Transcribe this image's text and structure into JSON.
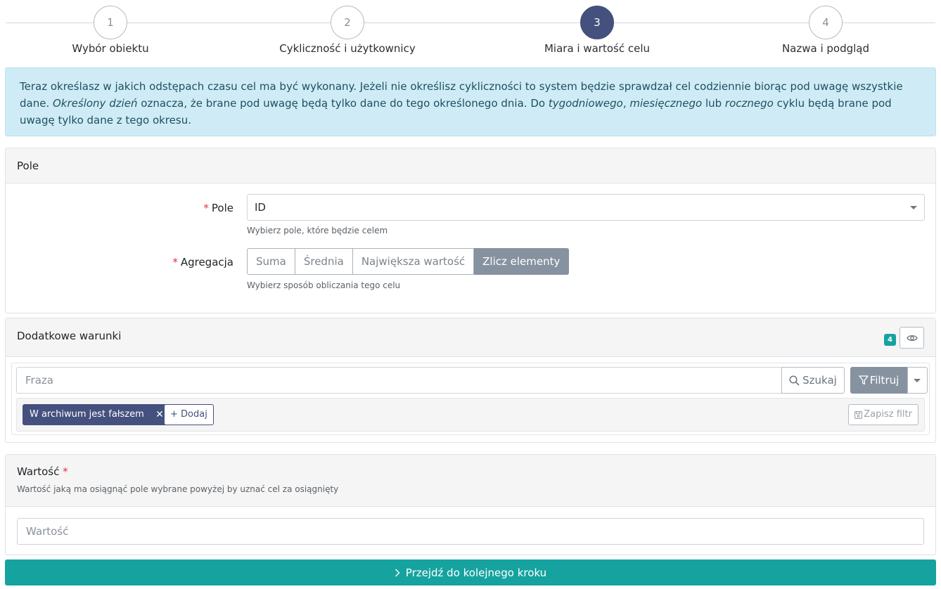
{
  "stepper": {
    "steps": [
      {
        "number": "1",
        "label": "Wybór obiektu"
      },
      {
        "number": "2",
        "label": "Cykliczność i użytkownicy"
      },
      {
        "number": "3",
        "label": "Miara i wartość celu"
      },
      {
        "number": "4",
        "label": "Nazwa i podgląd"
      }
    ],
    "active_step": 3
  },
  "info": {
    "text1": "Teraz określasz w jakich odstępach czasu cel ma być wykonany. Jeżeli nie określisz cykliczności to system będzie sprawdzał cel codziennie biorąc pod uwagę wszystkie dane.",
    "em1": "Określony dzień",
    "text2": " oznacza, że brane pod uwagę będą tylko dane do tego określonego dnia. Do ",
    "em2": "tygodniowego",
    "text3": ", ",
    "em3": "miesięcznego",
    "text4": " lub ",
    "em4": "rocznego",
    "text5": " cyklu będą brane pod uwagę tylko dane z tego okresu."
  },
  "pole_card": {
    "header": "Pole",
    "required_mark": "*",
    "pole_label": "Pole",
    "pole_value": "ID",
    "pole_help": "Wybierz pole, które będzie celem",
    "agregacja_label": "Agregacja",
    "agregacja_options": [
      "Suma",
      "Średnia",
      "Największa wartość",
      "Zlicz elementy"
    ],
    "agregacja_selected": "Zlicz elementy",
    "agregacja_help": "Wybierz sposób obliczania tego celu"
  },
  "warunki_card": {
    "header": "Dodatkowe warunki",
    "count_badge": "4",
    "search_placeholder": "Fraza",
    "search_button": "Szukaj",
    "filter_button": "Filtruj",
    "active_filter": "W archiwum jest fałszem",
    "add_button": "Dodaj",
    "save_filter_button": "Zapisz filtr"
  },
  "wartosc_card": {
    "title": "Wartość",
    "required_mark": "*",
    "subtitle": "Wartość jaką ma osiągnąć pole wybrane powyżej by uznać cel za osiągnięty",
    "input_placeholder": "Wartość"
  },
  "next_button": "Przejdź do kolejnego kroku",
  "colors": {
    "primary_dark": "#44507d",
    "teal": "#16a3a0",
    "info_bg": "#cfecf6",
    "segment_active": "#8792a0"
  }
}
